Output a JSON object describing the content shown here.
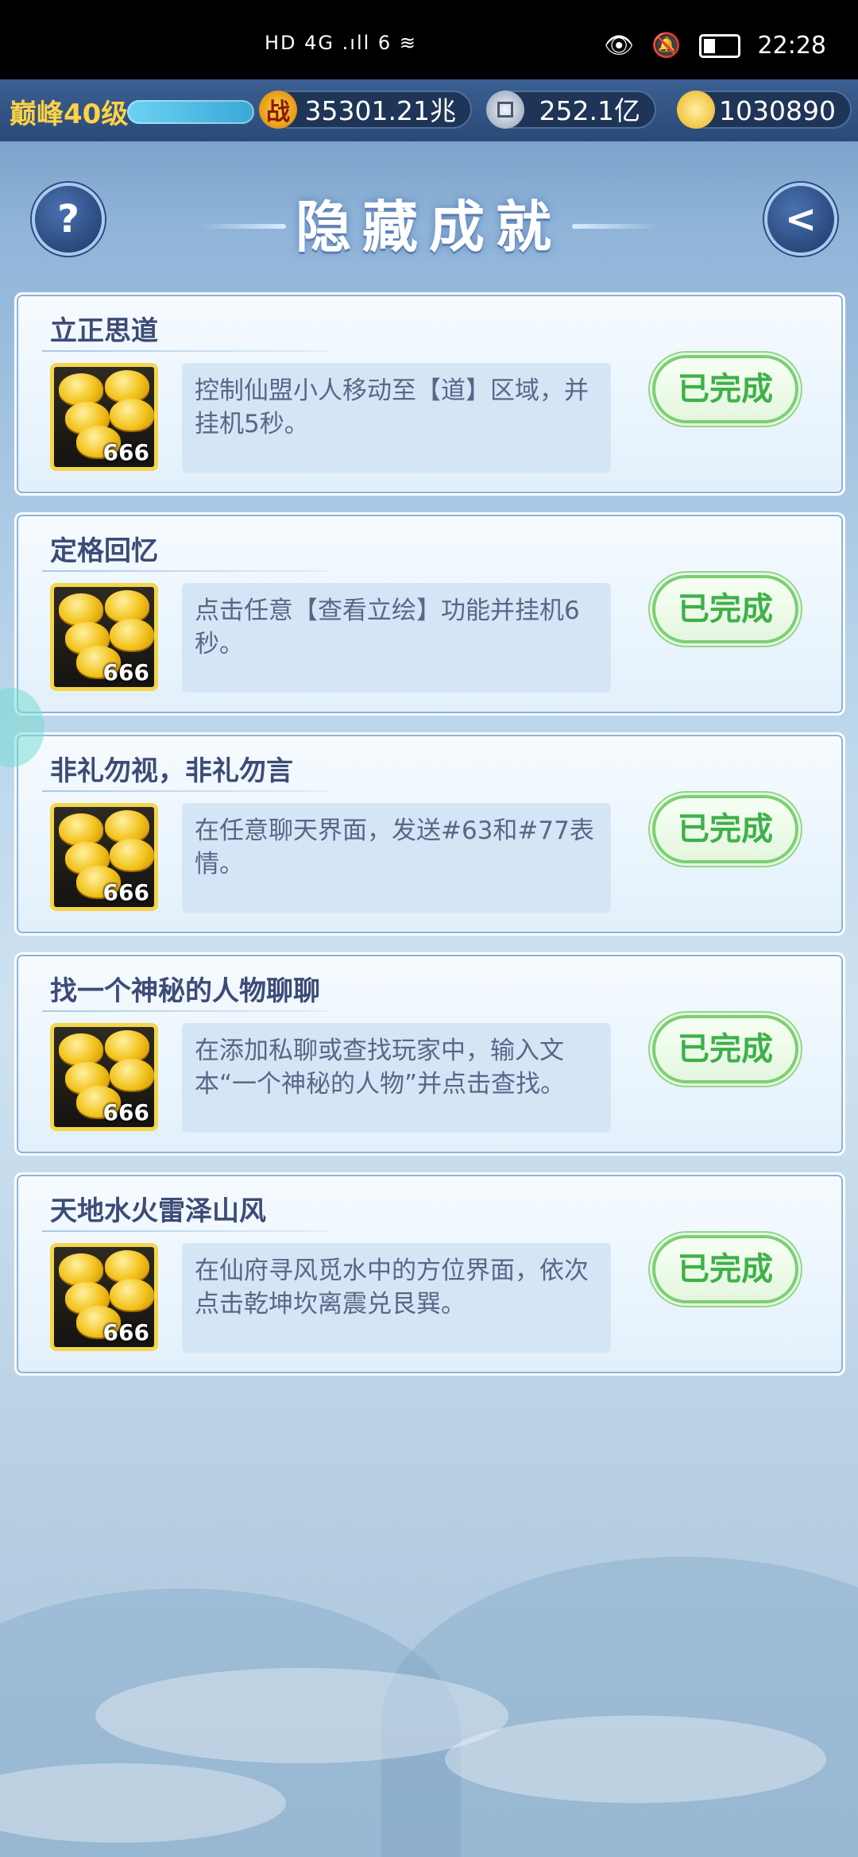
{
  "status_bar": {
    "network": "HD 4G .ıll 6 ≋",
    "time": "22:28"
  },
  "top_bar": {
    "level": "巅峰40级",
    "combat_icon": "战",
    "combat_power": "35301.21兆",
    "silver": "252.1亿",
    "gold": "1030890"
  },
  "title": "隐藏成就",
  "help_label": "?",
  "back_label": "<",
  "achievements": [
    {
      "title": "立正思道",
      "reward": "666",
      "desc": "控制仙盟小人移动至【道】区域，并挂机5秒。",
      "status": "已完成"
    },
    {
      "title": "定格回忆",
      "reward": "666",
      "desc": "点击任意【查看立绘】功能并挂机6秒。",
      "status": "已完成"
    },
    {
      "title": "非礼勿视，非礼勿言",
      "reward": "666",
      "desc": "在任意聊天界面，发送#63和#77表情。",
      "status": "已完成"
    },
    {
      "title": "找一个神秘的人物聊聊",
      "reward": "666",
      "desc": "在添加私聊或查找玩家中，输入文本“一个神秘的人物”并点击查找。",
      "status": "已完成"
    },
    {
      "title": "天地水火雷泽山风",
      "reward": "666",
      "desc": "在仙府寻风觅水中的方位界面，依次点击乾坤坎离震兑艮巽。",
      "status": "已完成"
    }
  ],
  "colors": {
    "done_green": "#3fb04a",
    "level_gold": "#ffd245",
    "title_ink": "#3d4b78"
  }
}
